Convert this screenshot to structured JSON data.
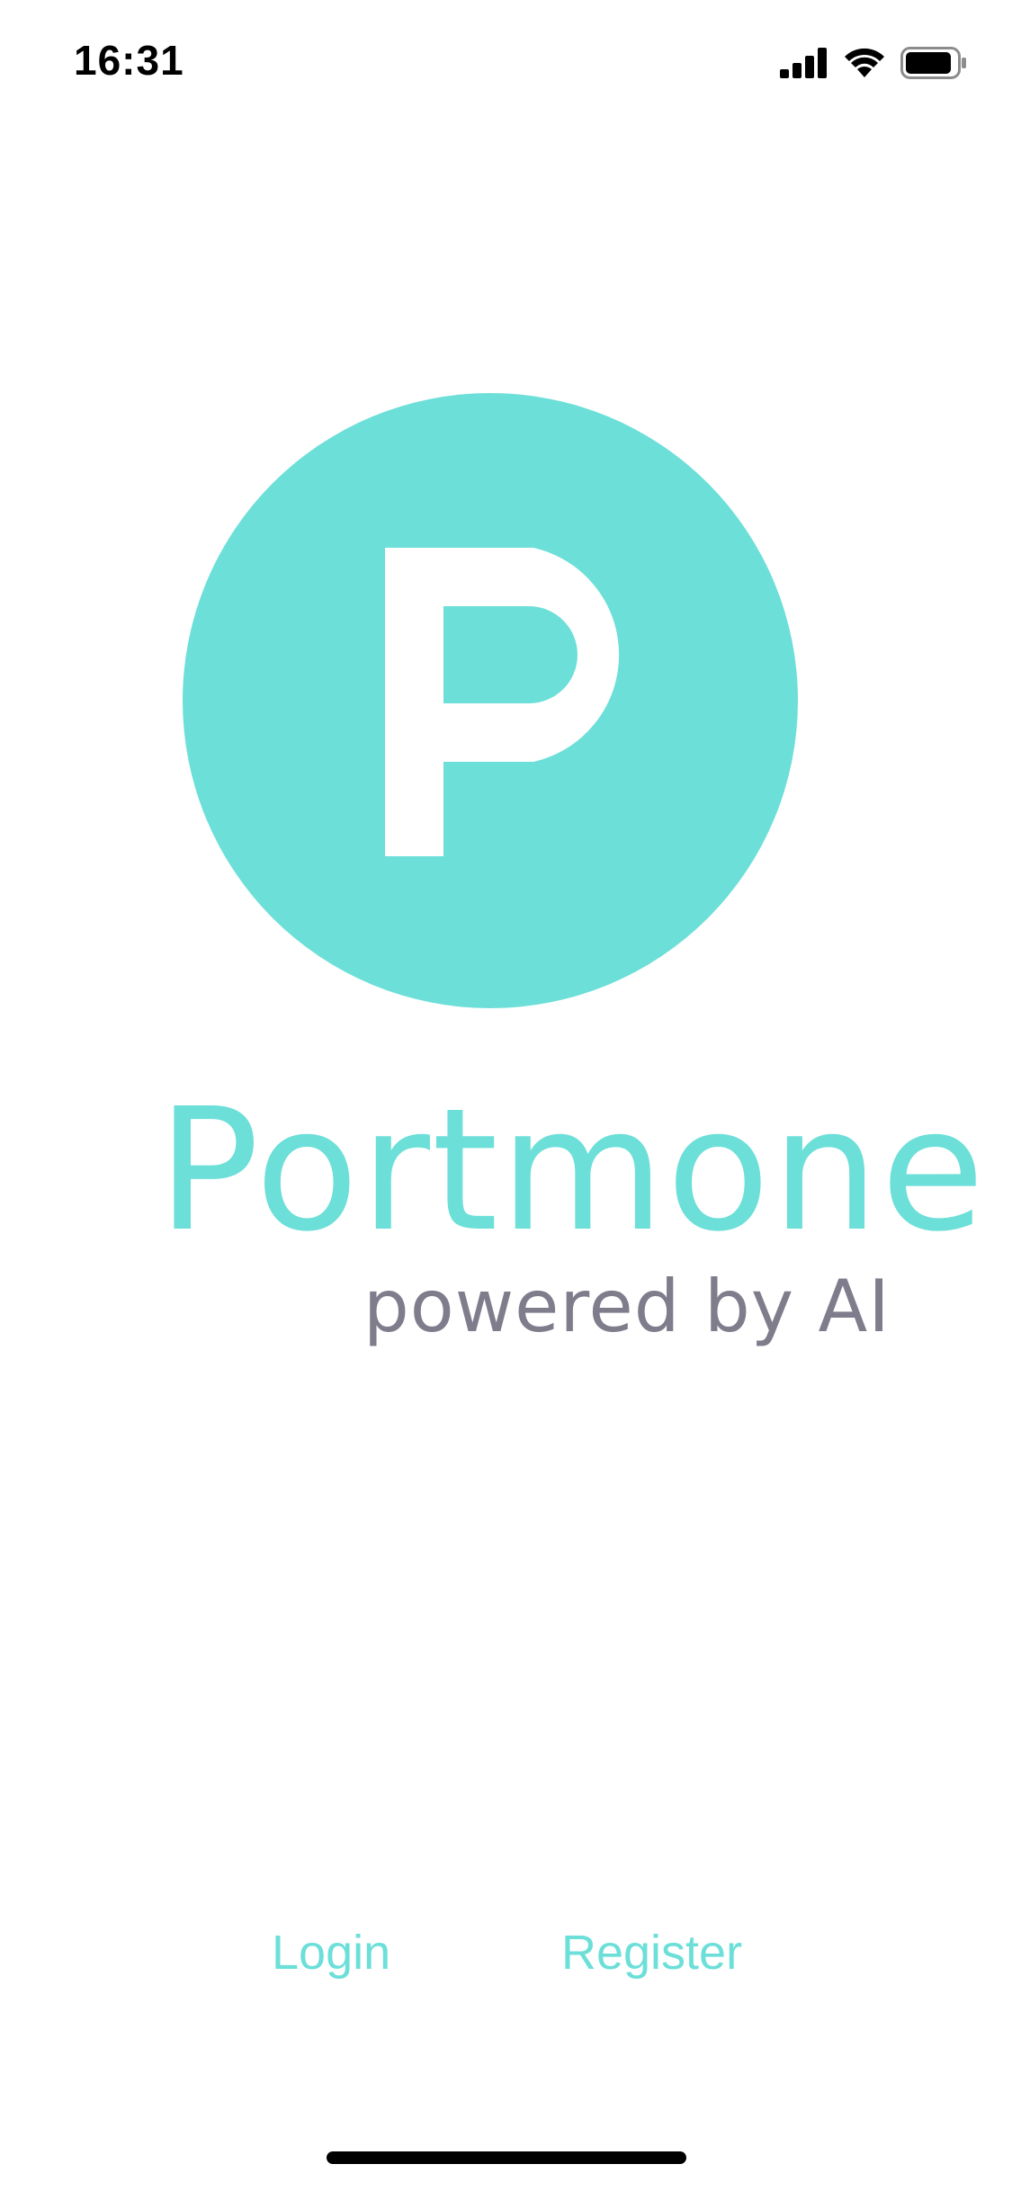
{
  "status_bar": {
    "time": "16:31",
    "icons": [
      "signal-icon",
      "wifi-icon",
      "battery-icon"
    ]
  },
  "brand": {
    "logo_icon": "portmone-p-logo-icon",
    "name": "Portmone",
    "tagline": "powered by AI",
    "accent_color": "#6cdfd8",
    "tagline_color": "#7f7d8c"
  },
  "actions": {
    "login_label": "Login",
    "register_label": "Register"
  }
}
